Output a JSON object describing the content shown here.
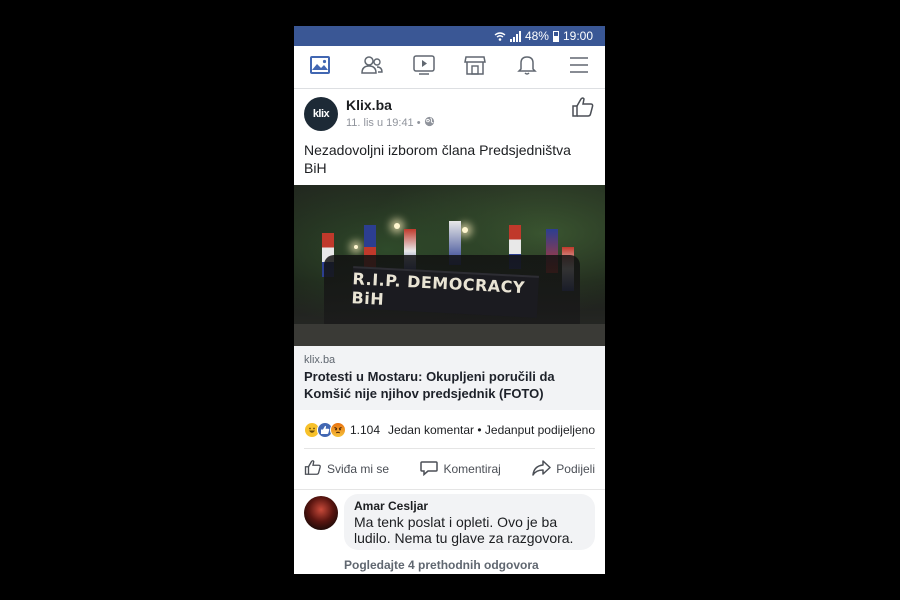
{
  "status_bar": {
    "battery": "48%",
    "time": "19:00"
  },
  "nav": {
    "items": [
      {
        "name": "news-feed",
        "icon": "news-feed-icon",
        "active": true
      },
      {
        "name": "friends",
        "icon": "friends-icon"
      },
      {
        "name": "watch",
        "icon": "video-play-icon"
      },
      {
        "name": "marketplace",
        "icon": "marketplace-icon"
      },
      {
        "name": "notifications",
        "icon": "bell-icon"
      },
      {
        "name": "menu",
        "icon": "hamburger-icon"
      }
    ],
    "accent_color": "#4267b2"
  },
  "post": {
    "page_logo_text": "klix",
    "page_name": "Klix.ba",
    "timestamp": "11. lis u 19:41",
    "separator": "•",
    "text": "Nezadovoljni izborom člana Predsjedništva BiH",
    "photo": {
      "banner_text": "R.I.P. DEMOCRACY BiH"
    },
    "link": {
      "domain": "klix.ba",
      "title": "Protesti u Mostaru: Okupljeni poručili da Komšić nije njihov predsjednik (FOTO)"
    },
    "reactions": {
      "icons": [
        "haha-icon",
        "like-icon",
        "angry-icon"
      ],
      "count": "1.104",
      "comments": "Jedan komentar",
      "separator": "•",
      "shares": "Jedanput podijeljeno"
    },
    "actions": {
      "like": "Sviđa mi se",
      "comment": "Komentiraj",
      "share": "Podijeli"
    }
  },
  "comment": {
    "author": "Amar Cesljar",
    "text": "Ma tenk poslat i opleti. Ovo je ba ludilo. Nema tu glave za razgovora.",
    "more_replies": "Pogledajte 4 prethodnih odgovora"
  }
}
